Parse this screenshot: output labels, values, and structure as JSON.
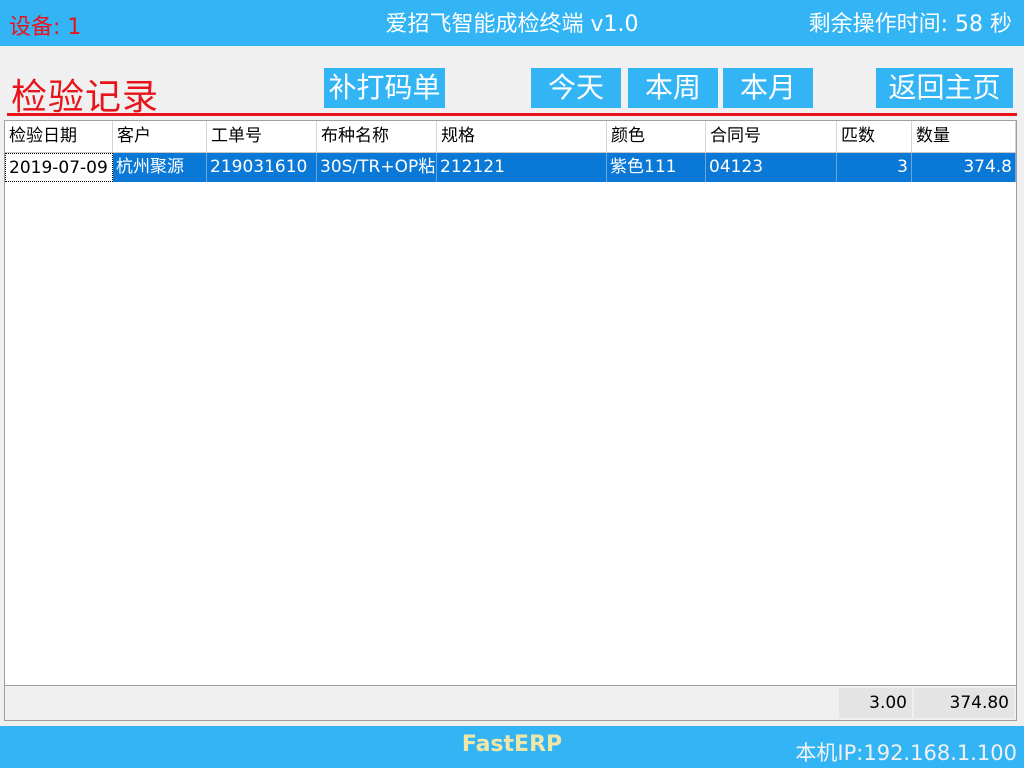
{
  "header": {
    "device": "设备: 1",
    "app_title": "爱招飞智能成检终端 v1.0",
    "remaining_time": "剩余操作时间: 58 秒"
  },
  "toolbar": {
    "page_title": "检验记录",
    "reprint_label": "补打码单",
    "today_label": "今天",
    "week_label": "本周",
    "month_label": "本月",
    "home_label": "返回主页"
  },
  "table": {
    "columns": [
      "检验日期",
      "客户",
      "工单号",
      "布种名称",
      "规格",
      "颜色",
      "合同号",
      "匹数",
      "数量"
    ],
    "rows": [
      [
        "2019-07-09",
        "杭州聚源",
        "219031610",
        "30S/TR+OP粘",
        "212121",
        "紫色111",
        "04123",
        "3",
        "374.8"
      ]
    ]
  },
  "totals": {
    "pieces": "3.00",
    "quantity": "374.80"
  },
  "footer": {
    "brand": "FastERP",
    "ip": "本机IP:192.168.1.100"
  },
  "colors": {
    "accent_blue": "#33b5f5",
    "title_red": "#e8141b",
    "selection_blue": "#0a78d6"
  }
}
